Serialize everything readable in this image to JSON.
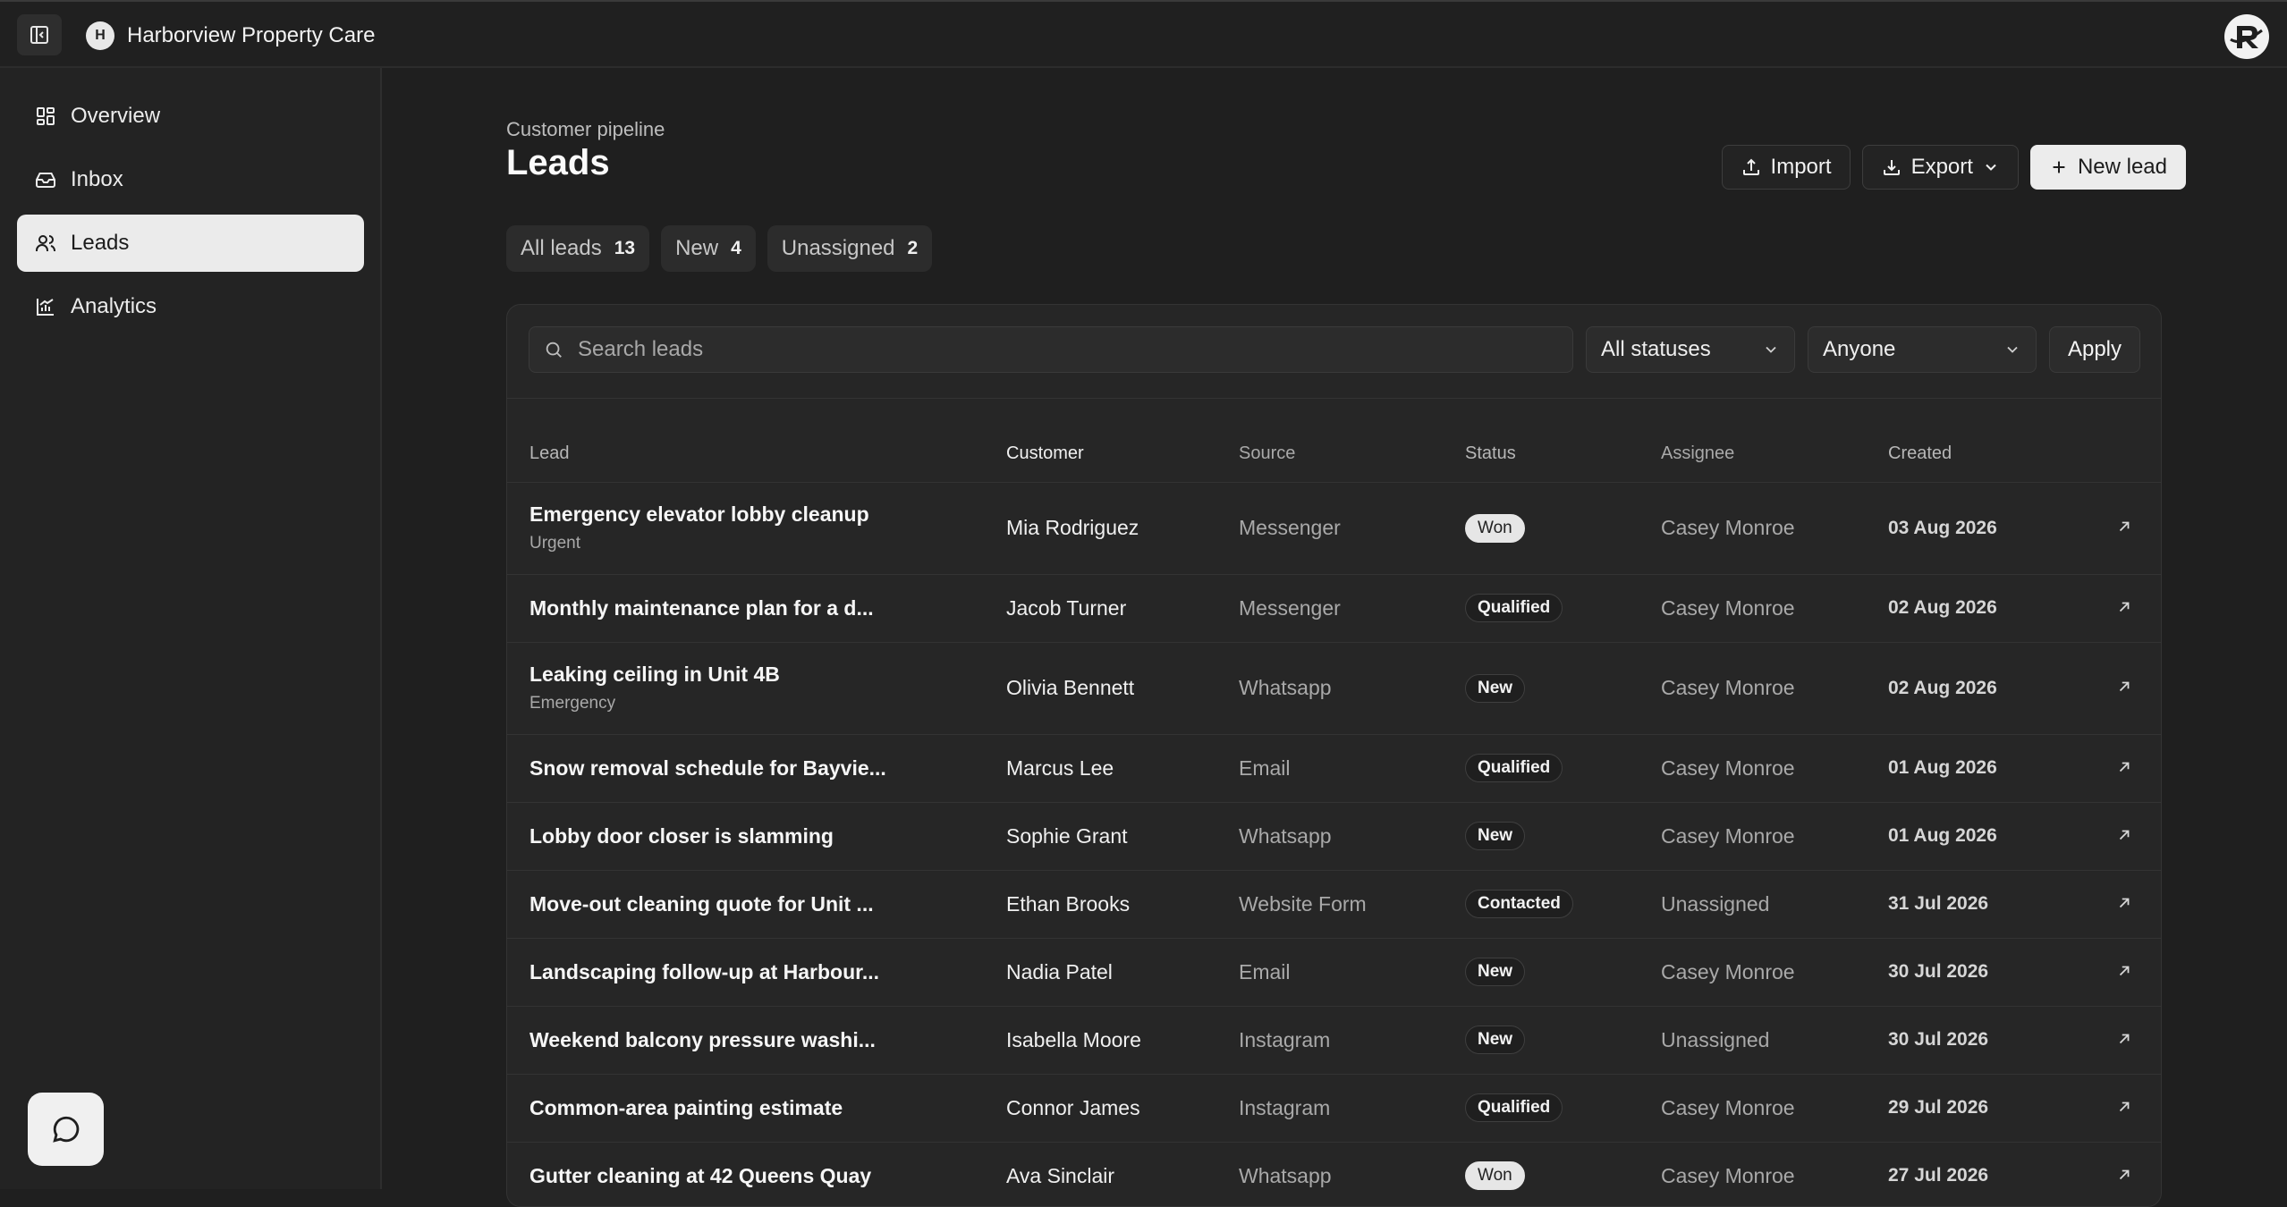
{
  "topbar": {
    "org_initial": "H",
    "org_name": "Harborview Property Care",
    "toggle_icon": "sidebar-toggle-icon",
    "brand_icon": "brand-logo-icon"
  },
  "sidebar": {
    "items": [
      {
        "label": "Overview",
        "icon": "grid-icon",
        "active": false
      },
      {
        "label": "Inbox",
        "icon": "inbox-icon",
        "active": false
      },
      {
        "label": "Leads",
        "icon": "users-icon",
        "active": true
      },
      {
        "label": "Analytics",
        "icon": "chart-icon",
        "active": false
      }
    ],
    "chat_icon": "chat-bubble-icon"
  },
  "page": {
    "eyebrow": "Customer pipeline",
    "title": "Leads"
  },
  "actions": {
    "import_label": "Import",
    "export_label": "Export",
    "new_label": "New lead"
  },
  "filters": [
    {
      "label": "All leads",
      "count": "13"
    },
    {
      "label": "New",
      "count": "4"
    },
    {
      "label": "Unassigned",
      "count": "2"
    }
  ],
  "toolbar": {
    "search_placeholder": "Search leads",
    "search_value": "",
    "status_selected": "All statuses",
    "assignee_selected": "Anyone",
    "apply_label": "Apply"
  },
  "table": {
    "headers": {
      "lead": "Lead",
      "customer": "Customer",
      "source": "Source",
      "status": "Status",
      "assignee": "Assignee",
      "created": "Created"
    },
    "rows": [
      {
        "title": "Emergency elevator lobby cleanup",
        "tag": "Urgent",
        "customer": "Mia Rodriguez",
        "source": "Messenger",
        "status": "Won",
        "assignee": "Casey Monroe",
        "created": "03 Aug 2026"
      },
      {
        "title": "Monthly maintenance plan for a d...",
        "tag": "",
        "customer": "Jacob Turner",
        "source": "Messenger",
        "status": "Qualified",
        "assignee": "Casey Monroe",
        "created": "02 Aug 2026"
      },
      {
        "title": "Leaking ceiling in Unit 4B",
        "tag": "Emergency",
        "customer": "Olivia Bennett",
        "source": "Whatsapp",
        "status": "New",
        "assignee": "Casey Monroe",
        "created": "02 Aug 2026"
      },
      {
        "title": "Snow removal schedule for Bayvie...",
        "tag": "",
        "customer": "Marcus Lee",
        "source": "Email",
        "status": "Qualified",
        "assignee": "Casey Monroe",
        "created": "01 Aug 2026"
      },
      {
        "title": "Lobby door closer is slamming",
        "tag": "",
        "customer": "Sophie Grant",
        "source": "Whatsapp",
        "status": "New",
        "assignee": "Casey Monroe",
        "created": "01 Aug 2026"
      },
      {
        "title": "Move-out cleaning quote for Unit ...",
        "tag": "",
        "customer": "Ethan Brooks",
        "source": "Website Form",
        "status": "Contacted",
        "assignee": "Unassigned",
        "created": "31 Jul 2026"
      },
      {
        "title": "Landscaping follow-up at Harbour...",
        "tag": "",
        "customer": "Nadia Patel",
        "source": "Email",
        "status": "New",
        "assignee": "Casey Monroe",
        "created": "30 Jul 2026"
      },
      {
        "title": "Weekend balcony pressure washi...",
        "tag": "",
        "customer": "Isabella Moore",
        "source": "Instagram",
        "status": "New",
        "assignee": "Unassigned",
        "created": "30 Jul 2026"
      },
      {
        "title": "Common-area painting estimate",
        "tag": "",
        "customer": "Connor James",
        "source": "Instagram",
        "status": "Qualified",
        "assignee": "Casey Monroe",
        "created": "29 Jul 2026"
      },
      {
        "title": "Gutter cleaning at 42 Queens Quay",
        "tag": "",
        "customer": "Ava Sinclair",
        "source": "Whatsapp",
        "status": "Won",
        "assignee": "Casey Monroe",
        "created": "27 Jul 2026"
      }
    ]
  }
}
